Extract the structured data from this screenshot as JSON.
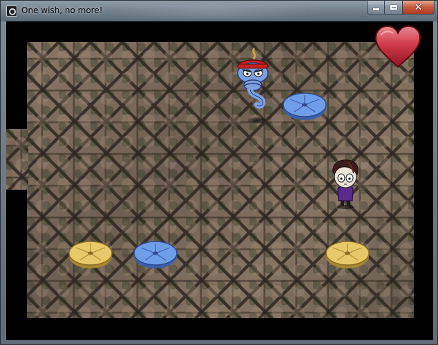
{
  "window": {
    "title": "One wish, no more!",
    "controls": {
      "minimize_icon": "minimize-icon",
      "maximize_icon": "maximize-icon",
      "close_glyph": "✕"
    }
  },
  "game": {
    "lives_icon": "heart-icon",
    "colors": {
      "heart": "#c0202e",
      "blue_cushion": "#6f9ee8",
      "yellow_cushion": "#e8c96a",
      "genie": "#7da0e0",
      "hat": "#c82020",
      "player_shirt": "#5a2a8c"
    },
    "entities": [
      {
        "name": "genie",
        "icon": "genie-sprite"
      },
      {
        "name": "player",
        "icon": "boy-sprite"
      },
      {
        "name": "cushion-blue-1",
        "color": "blue"
      },
      {
        "name": "cushion-blue-2",
        "color": "blue"
      },
      {
        "name": "cushion-yellow-1",
        "color": "yellow"
      },
      {
        "name": "cushion-yellow-2",
        "color": "yellow"
      }
    ]
  }
}
